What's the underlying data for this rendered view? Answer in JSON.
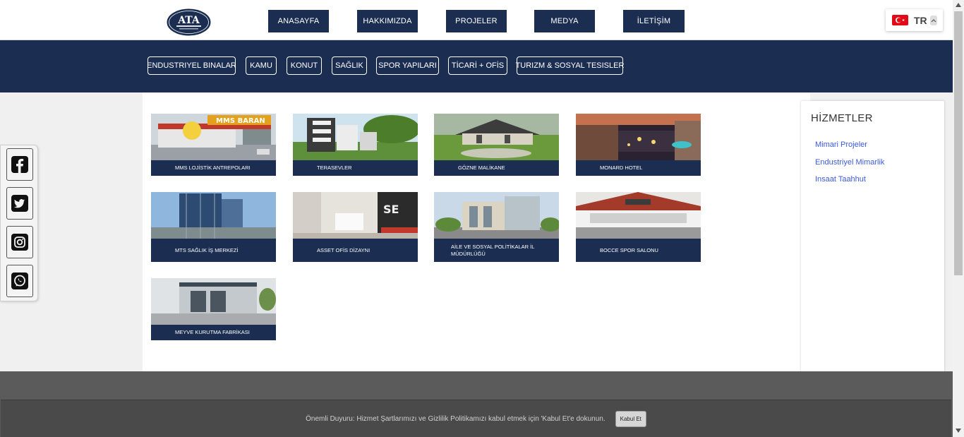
{
  "header": {
    "nav": [
      "ANASAYFA",
      "HAKKIMIZDA",
      "PROJELER",
      "MEDYA",
      "İLETİŞİM"
    ],
    "language": "TR"
  },
  "categories": [
    "ENDUSTRIYEL BINALAR",
    "KAMU",
    "KONUT",
    "SAĞLIK",
    "SPOR YAPILARI",
    "TİCARİ + OFİS",
    "TURIZM & SOSYAL TESISLER"
  ],
  "projects": [
    {
      "title": "MMS LOJİSTİK ANTREPOLARI"
    },
    {
      "title": "TERASEVLER"
    },
    {
      "title": "GÖZNE MALİKANE"
    },
    {
      "title": "MONARD HOTEL"
    },
    {
      "title": "MTS SAĞLIK İŞ MERKEZİ"
    },
    {
      "title": "ASSET OFİS DİZAYNI"
    },
    {
      "title": "AİLE VE SOSYAL POLİTİKALAR İL MÜDÜRLÜĞÜ"
    },
    {
      "title": "BOCCE SPOR SALONU"
    },
    {
      "title": "MEYVE KURUTMA FABRİKASI"
    }
  ],
  "sidebar": {
    "title": "HİZMETLER",
    "links": [
      "Mimari Projeler",
      "Endustriyel Mimarlik",
      "Insaat Taahhut"
    ]
  },
  "social": [
    "facebook-icon",
    "twitter-icon",
    "instagram-icon",
    "whatsapp-icon"
  ],
  "cookie": {
    "text": "Önemli Duyuru: Hizmet Şartlarımızı ve Gizlilik Politikamızı kabul etmek için 'Kabul Et'e dokunun.",
    "button": "Kabul Et"
  },
  "colors": {
    "brand_navy": "#1b2e52",
    "link_blue": "#3b5bdb",
    "turkish_red": "#e30a17"
  }
}
